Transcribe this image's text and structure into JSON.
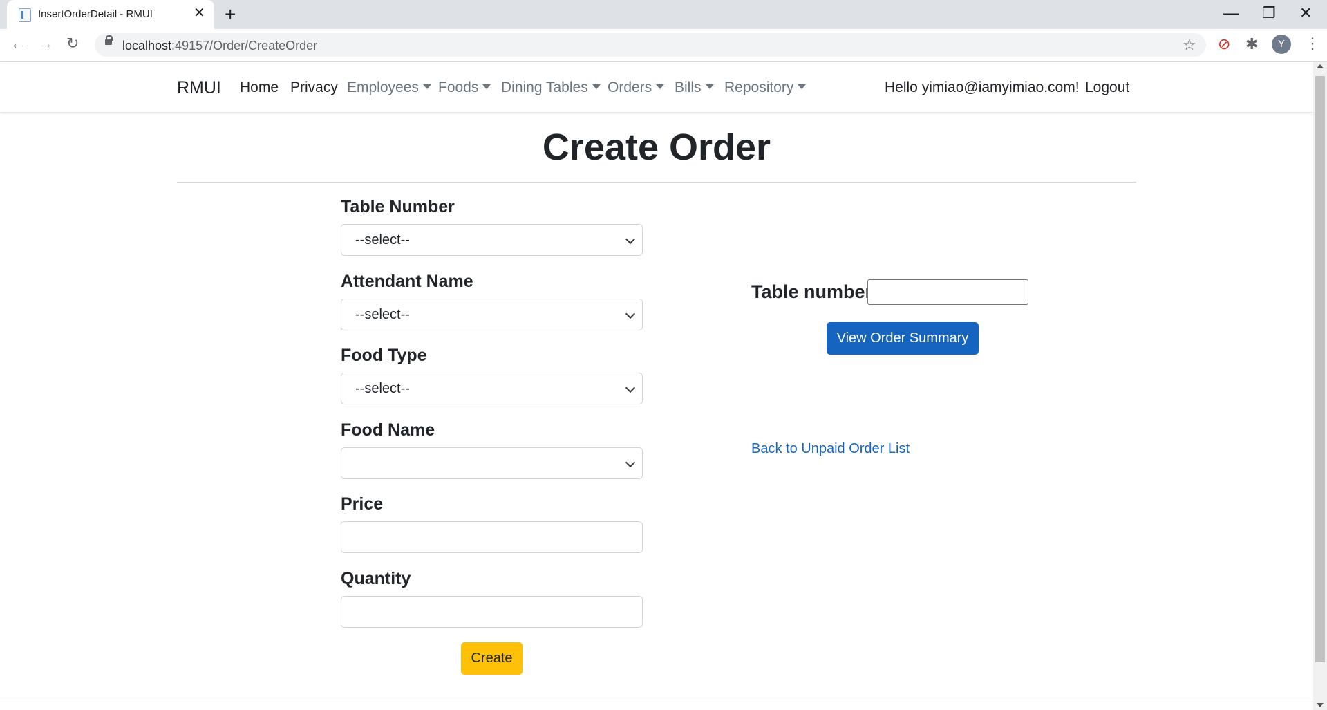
{
  "browser": {
    "tab_title": "InsertOrderDetail - RMUI",
    "url_host": "localhost",
    "url_rest": ":49157/Order/CreateOrder",
    "avatar_letter": "Y"
  },
  "navbar": {
    "brand": "RMUI",
    "links": [
      {
        "label": "Home",
        "dropdown": false
      },
      {
        "label": "Privacy",
        "dropdown": false
      },
      {
        "label": "Employees",
        "dropdown": true
      },
      {
        "label": "Foods",
        "dropdown": true
      },
      {
        "label": "Dining Tables",
        "dropdown": true
      },
      {
        "label": "Orders",
        "dropdown": true
      },
      {
        "label": "Bills",
        "dropdown": true
      },
      {
        "label": "Repository",
        "dropdown": true
      }
    ],
    "greeting": "Hello yimiao@iamyimiao.com!",
    "logout": "Logout"
  },
  "page": {
    "title": "Create Order"
  },
  "form": {
    "table_number": {
      "label": "Table Number",
      "value": "--select--"
    },
    "attendant_name": {
      "label": "Attendant Name",
      "value": "--select--"
    },
    "food_type": {
      "label": "Food Type",
      "value": "--select--"
    },
    "food_name": {
      "label": "Food Name",
      "value": ""
    },
    "price": {
      "label": "Price",
      "value": ""
    },
    "quantity": {
      "label": "Quantity",
      "value": ""
    },
    "submit": "Create"
  },
  "side": {
    "table_number_label": "Table number:",
    "table_number_value": "",
    "summary_button": "View Order Summary",
    "back_link": "Back to Unpaid Order List"
  },
  "colors": {
    "primary": "#1565c0",
    "warning": "#ffc107"
  }
}
